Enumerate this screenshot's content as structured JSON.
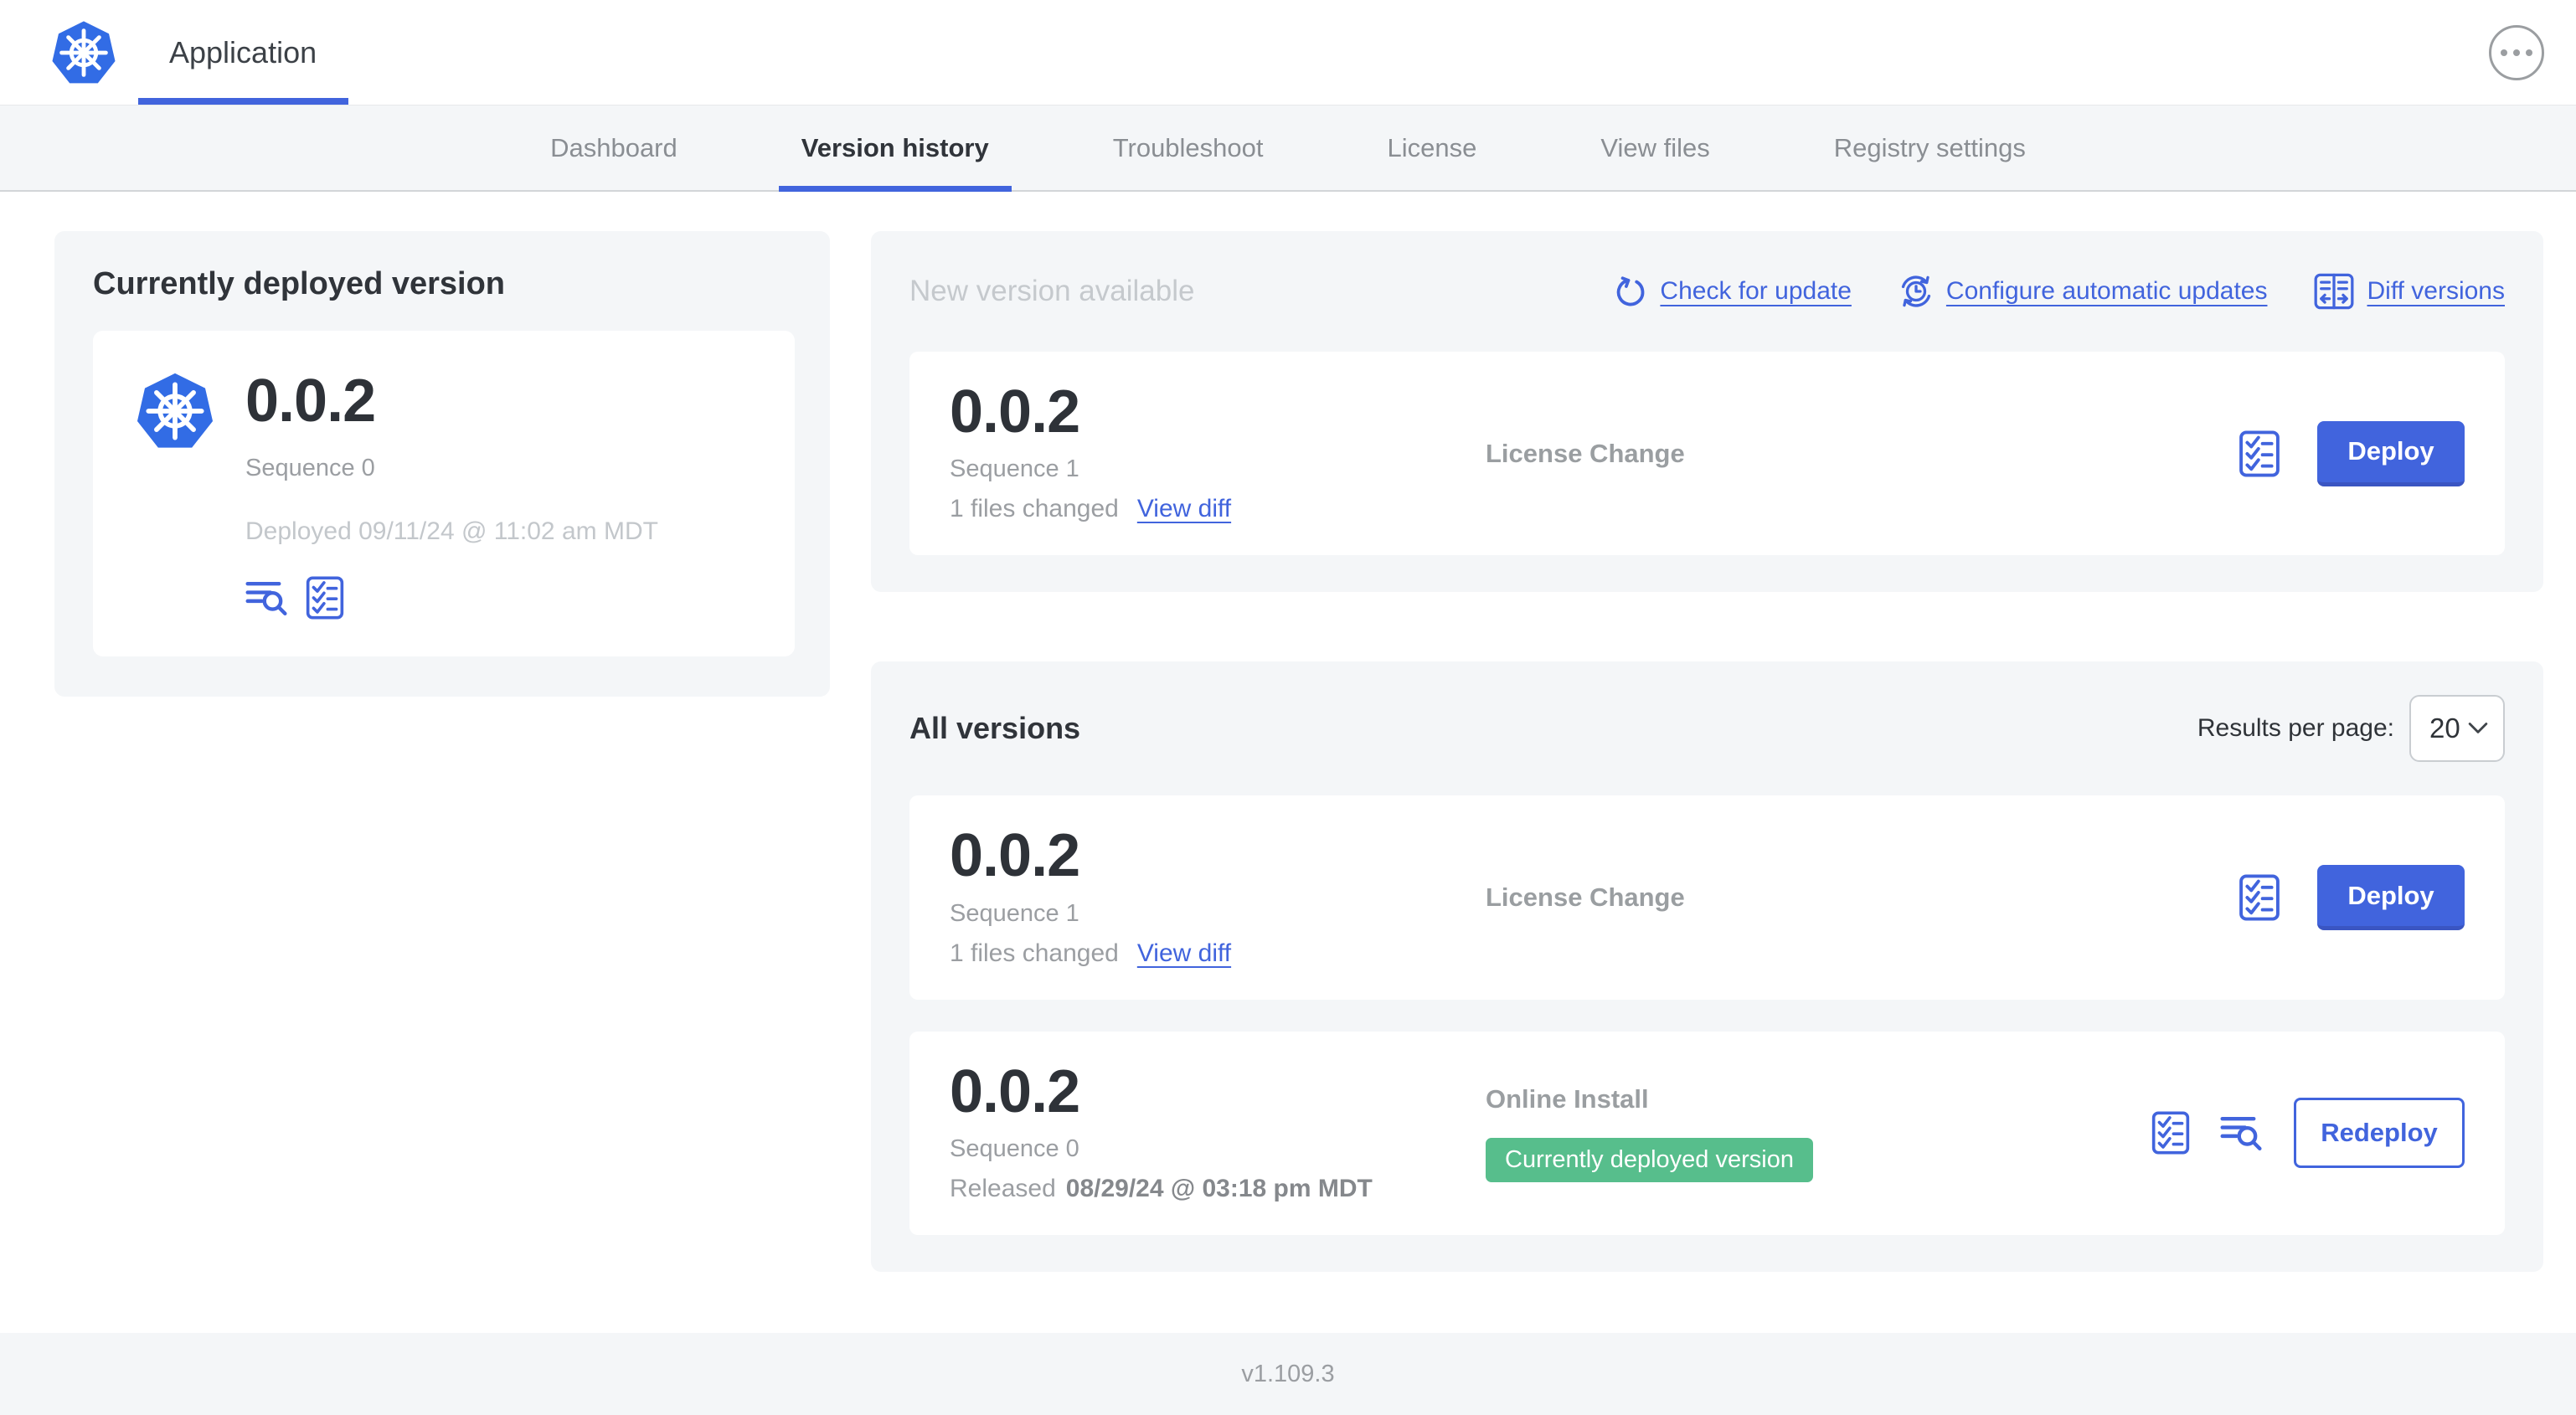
{
  "header": {
    "app_label": "Application"
  },
  "nav": {
    "tabs": [
      {
        "label": "Dashboard",
        "active": false
      },
      {
        "label": "Version history",
        "active": true
      },
      {
        "label": "Troubleshoot",
        "active": false
      },
      {
        "label": "License",
        "active": false
      },
      {
        "label": "View files",
        "active": false
      },
      {
        "label": "Registry settings",
        "active": false
      }
    ]
  },
  "deployed_card": {
    "title": "Currently deployed version",
    "version": "0.0.2",
    "sequence": "Sequence 0",
    "deployed_at": "Deployed 09/11/24 @ 11:02 am MDT"
  },
  "new_version": {
    "title": "New version available",
    "actions": {
      "check_for_update": "Check for update",
      "configure_automatic_updates": "Configure automatic updates",
      "diff_versions": "Diff versions"
    },
    "row": {
      "version": "0.0.2",
      "sequence": "Sequence 1",
      "files_changed": "1 files changed",
      "view_diff": "View diff",
      "source": "License Change",
      "deploy": "Deploy"
    }
  },
  "all_versions": {
    "title": "All versions",
    "results_per_page_label": "Results per page:",
    "results_per_page_value": "20",
    "rows": [
      {
        "version": "0.0.2",
        "sequence": "Sequence 1",
        "files_changed": "1 files changed",
        "view_diff": "View diff",
        "source": "License Change",
        "action": "Deploy"
      },
      {
        "version": "0.0.2",
        "sequence": "Sequence 0",
        "released_prefix": "Released",
        "released_date": "08/29/24 @ 03:18 pm MDT",
        "source": "Online Install",
        "badge": "Currently deployed version",
        "action": "Redeploy"
      }
    ]
  },
  "footer": {
    "app_version": "v1.109.3"
  },
  "colors": {
    "accent_blue": "#4164dd",
    "kubernetes_blue": "#326ce5",
    "badge_green": "#57be8c",
    "panel_gray": "#f4f6f8",
    "dark_text": "#30343a",
    "gray_text": "#9b9ea2",
    "light_gray_text": "#c5c9cd"
  },
  "icons": {
    "app_logo": "kubernetes-helm-wheel",
    "more_options": "ellipsis-in-circle",
    "check_for_update": "circular-refresh-arrow",
    "configure_automatic_updates": "clock-with-sync-arrows",
    "diff_versions": "split-panel-with-arrows",
    "deploy_logs": "text-lines-with-magnifier",
    "preflight_checks": "checklist",
    "results_select": "chevron-down"
  }
}
